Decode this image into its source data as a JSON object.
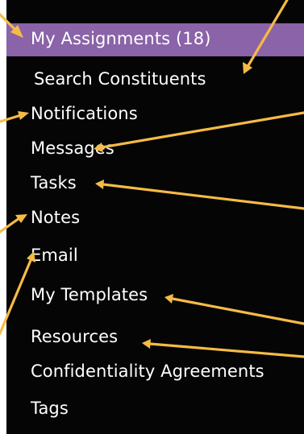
{
  "colors": {
    "background": "#ffffff",
    "panel": "#050505",
    "active_highlight": "#8a63a8",
    "arrow": "#f6bb46",
    "text": "#ffffff"
  },
  "menu": {
    "items": [
      {
        "label": "My Assignments (18)",
        "active": true
      },
      {
        "label": "Search Constituents",
        "active": false
      },
      {
        "label": "Notifications",
        "active": false
      },
      {
        "label": "Messages",
        "active": false
      },
      {
        "label": "Tasks",
        "active": false
      },
      {
        "label": "Notes",
        "active": false
      },
      {
        "label": "Email",
        "active": false
      },
      {
        "label": "My Templates",
        "active": false
      },
      {
        "label": "Resources",
        "active": false
      },
      {
        "label": "Confidentiality Agreements",
        "active": false
      },
      {
        "label": "Tags",
        "active": false
      }
    ]
  }
}
